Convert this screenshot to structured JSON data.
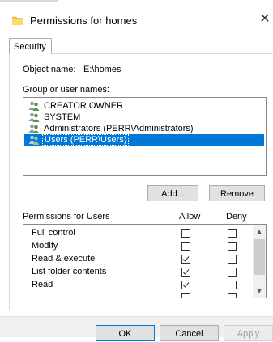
{
  "window": {
    "title": "Permissions for homes",
    "close_glyph": "✕"
  },
  "tabs": [
    {
      "label": "Security"
    }
  ],
  "object": {
    "label": "Object name:",
    "value": "E:\\homes"
  },
  "groups": {
    "label": "Group or user names:",
    "items": [
      {
        "name": "CREATOR OWNER",
        "icon": "users-icon",
        "selected": false
      },
      {
        "name": "SYSTEM",
        "icon": "users-icon",
        "selected": false
      },
      {
        "name": "Administrators (PERR\\Administrators)",
        "icon": "users-icon",
        "selected": false
      },
      {
        "name": "Users (PERR\\Users)",
        "icon": "users-icon",
        "selected": true
      }
    ],
    "add_label": "Add...",
    "remove_label": "Remove"
  },
  "permissions": {
    "title": "Permissions for Users",
    "allow_header": "Allow",
    "deny_header": "Deny",
    "rows": [
      {
        "name": "Full control",
        "allow": false,
        "deny": false
      },
      {
        "name": "Modify",
        "allow": false,
        "deny": false
      },
      {
        "name": "Read & execute",
        "allow": true,
        "deny": false
      },
      {
        "name": "List folder contents",
        "allow": true,
        "deny": false
      },
      {
        "name": "Read",
        "allow": true,
        "deny": false
      }
    ]
  },
  "footer": {
    "ok_label": "OK",
    "cancel_label": "Cancel",
    "apply_label": "Apply"
  },
  "colors": {
    "selection": "#0078d7",
    "folder": "#f3c24b"
  }
}
